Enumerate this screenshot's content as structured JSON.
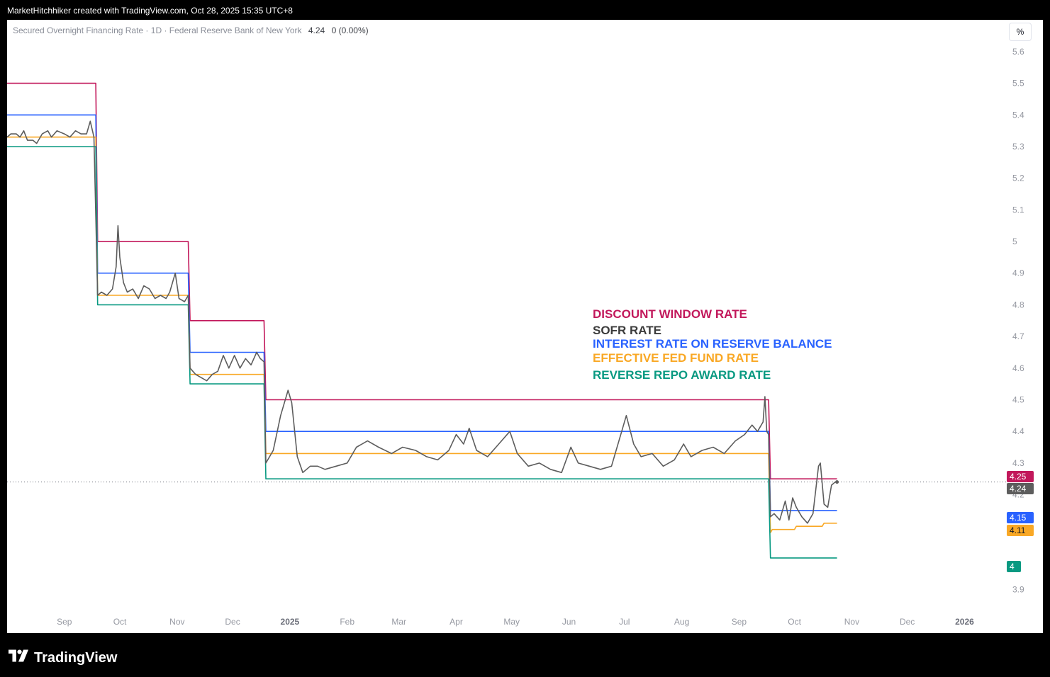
{
  "header": {
    "credit": "MarketHitchhiker created with TradingView.com, Oct 28, 2025 15:35 UTC+8"
  },
  "legend": {
    "title": "Secured Overnight Financing Rate · 1D · Federal Reserve Bank of New York",
    "last_value": "4.24",
    "change": "0 (0.00%)"
  },
  "unit_button": "%",
  "footer": {
    "brand": "TradingView"
  },
  "colors": {
    "discount": "#c2185b",
    "sofr": "#5d5d5d",
    "iorb": "#2962ff",
    "effr": "#f9a825",
    "rrp": "#089981"
  },
  "chart_data": {
    "type": "line",
    "title": "",
    "ylim": [
      3.87,
      5.62
    ],
    "y_ticks": [
      "5.6",
      "5.5",
      "5.4",
      "5.3",
      "5.2",
      "5.1",
      "5",
      "4.9",
      "4.8",
      "4.7",
      "4.6",
      "4.5",
      "4.4",
      "4.3",
      "4.2",
      "3.9"
    ],
    "x_ticks": [
      "Sep",
      "Oct",
      "Nov",
      "Dec",
      "2025",
      "Feb",
      "Mar",
      "Apr",
      "May",
      "Jun",
      "Jul",
      "Aug",
      "Sep",
      "Oct",
      "Nov",
      "Dec",
      "2026"
    ],
    "x_range": [
      "2024-08-01",
      "2026-01-20"
    ],
    "annotations": [
      "DISCOUNT WINDOW RATE",
      "SOFR RATE",
      "INTEREST RATE ON RESERVE BALANCE",
      "EFFECTIVE FED FUND RATE",
      " REVERSE REPO AWARD RATE"
    ],
    "series": [
      {
        "key": "discount",
        "color": "#c2185b",
        "points": [
          [
            "2024-08-01",
            5.5
          ],
          [
            "2024-09-18",
            5.5
          ],
          [
            "2024-09-19",
            5.0
          ],
          [
            "2024-11-07",
            5.0
          ],
          [
            "2024-11-08",
            4.75
          ],
          [
            "2024-12-18",
            4.75
          ],
          [
            "2024-12-19",
            4.5
          ],
          [
            "2025-09-17",
            4.5
          ],
          [
            "2025-09-18",
            4.25
          ],
          [
            "2025-10-24",
            4.25
          ]
        ],
        "last_label": "4.25"
      },
      {
        "key": "iorb",
        "color": "#2962ff",
        "points": [
          [
            "2024-08-01",
            5.4
          ],
          [
            "2024-09-18",
            5.4
          ],
          [
            "2024-09-19",
            4.9
          ],
          [
            "2024-11-07",
            4.9
          ],
          [
            "2024-11-08",
            4.65
          ],
          [
            "2024-12-18",
            4.65
          ],
          [
            "2024-12-19",
            4.4
          ],
          [
            "2025-09-17",
            4.4
          ],
          [
            "2025-09-18",
            4.15
          ],
          [
            "2025-10-24",
            4.15
          ]
        ],
        "last_label": "4.15"
      },
      {
        "key": "effr",
        "color": "#f9a825",
        "points": [
          [
            "2024-08-01",
            5.33
          ],
          [
            "2024-09-18",
            5.33
          ],
          [
            "2024-09-19",
            4.83
          ],
          [
            "2024-11-07",
            4.83
          ],
          [
            "2024-11-08",
            4.58
          ],
          [
            "2024-12-18",
            4.58
          ],
          [
            "2024-12-19",
            4.33
          ],
          [
            "2025-09-17",
            4.33
          ],
          [
            "2025-09-18",
            4.08
          ],
          [
            "2025-09-19",
            4.09
          ],
          [
            "2025-10-01",
            4.09
          ],
          [
            "2025-10-02",
            4.1
          ],
          [
            "2025-10-16",
            4.1
          ],
          [
            "2025-10-17",
            4.11
          ],
          [
            "2025-10-24",
            4.11
          ]
        ],
        "last_label": "4.11"
      },
      {
        "key": "rrp",
        "color": "#089981",
        "points": [
          [
            "2024-08-01",
            5.3
          ],
          [
            "2024-09-18",
            5.3
          ],
          [
            "2024-09-19",
            4.8
          ],
          [
            "2024-11-07",
            4.8
          ],
          [
            "2024-11-08",
            4.55
          ],
          [
            "2024-12-18",
            4.55
          ],
          [
            "2024-12-19",
            4.25
          ],
          [
            "2025-09-17",
            4.25
          ],
          [
            "2025-09-18",
            4.0
          ],
          [
            "2025-10-24",
            4.0
          ]
        ],
        "last_label": "4"
      },
      {
        "key": "sofr",
        "color": "#5d5d5d",
        "points": [
          [
            "2024-08-01",
            5.33
          ],
          [
            "2024-08-03",
            5.34
          ],
          [
            "2024-08-06",
            5.34
          ],
          [
            "2024-08-08",
            5.33
          ],
          [
            "2024-08-10",
            5.35
          ],
          [
            "2024-08-12",
            5.32
          ],
          [
            "2024-08-15",
            5.32
          ],
          [
            "2024-08-17",
            5.31
          ],
          [
            "2024-08-20",
            5.34
          ],
          [
            "2024-08-23",
            5.35
          ],
          [
            "2024-08-25",
            5.33
          ],
          [
            "2024-08-28",
            5.35
          ],
          [
            "2024-09-01",
            5.34
          ],
          [
            "2024-09-04",
            5.33
          ],
          [
            "2024-09-07",
            5.35
          ],
          [
            "2024-09-10",
            5.34
          ],
          [
            "2024-09-13",
            5.34
          ],
          [
            "2024-09-15",
            5.38
          ],
          [
            "2024-09-17",
            5.33
          ],
          [
            "2024-09-19",
            4.83
          ],
          [
            "2024-09-21",
            4.84
          ],
          [
            "2024-09-24",
            4.83
          ],
          [
            "2024-09-27",
            4.85
          ],
          [
            "2024-09-29",
            4.92
          ],
          [
            "2024-09-30",
            5.05
          ],
          [
            "2024-10-01",
            4.95
          ],
          [
            "2024-10-03",
            4.87
          ],
          [
            "2024-10-05",
            4.84
          ],
          [
            "2024-10-08",
            4.85
          ],
          [
            "2024-10-11",
            4.82
          ],
          [
            "2024-10-14",
            4.86
          ],
          [
            "2024-10-17",
            4.85
          ],
          [
            "2024-10-20",
            4.82
          ],
          [
            "2024-10-23",
            4.83
          ],
          [
            "2024-10-26",
            4.82
          ],
          [
            "2024-10-28",
            4.84
          ],
          [
            "2024-10-31",
            4.9
          ],
          [
            "2024-11-02",
            4.82
          ],
          [
            "2024-11-05",
            4.81
          ],
          [
            "2024-11-07",
            4.83
          ],
          [
            "2024-11-08",
            4.6
          ],
          [
            "2024-11-11",
            4.58
          ],
          [
            "2024-11-14",
            4.57
          ],
          [
            "2024-11-17",
            4.56
          ],
          [
            "2024-11-20",
            4.58
          ],
          [
            "2024-11-23",
            4.59
          ],
          [
            "2024-11-26",
            4.64
          ],
          [
            "2024-11-29",
            4.6
          ],
          [
            "2024-12-02",
            4.64
          ],
          [
            "2024-12-05",
            4.6
          ],
          [
            "2024-12-08",
            4.63
          ],
          [
            "2024-12-11",
            4.61
          ],
          [
            "2024-12-14",
            4.65
          ],
          [
            "2024-12-16",
            4.63
          ],
          [
            "2024-12-18",
            4.62
          ],
          [
            "2024-12-19",
            4.3
          ],
          [
            "2024-12-23",
            4.34
          ],
          [
            "2024-12-27",
            4.45
          ],
          [
            "2024-12-31",
            4.53
          ],
          [
            "2025-01-02",
            4.49
          ],
          [
            "2025-01-05",
            4.32
          ],
          [
            "2025-01-08",
            4.27
          ],
          [
            "2025-01-12",
            4.29
          ],
          [
            "2025-01-16",
            4.29
          ],
          [
            "2025-01-20",
            4.28
          ],
          [
            "2025-01-26",
            4.29
          ],
          [
            "2025-02-01",
            4.3
          ],
          [
            "2025-02-06",
            4.35
          ],
          [
            "2025-02-12",
            4.37
          ],
          [
            "2025-02-18",
            4.35
          ],
          [
            "2025-02-25",
            4.33
          ],
          [
            "2025-03-03",
            4.35
          ],
          [
            "2025-03-10",
            4.34
          ],
          [
            "2025-03-16",
            4.32
          ],
          [
            "2025-03-22",
            4.31
          ],
          [
            "2025-03-28",
            4.34
          ],
          [
            "2025-04-01",
            4.39
          ],
          [
            "2025-04-05",
            4.36
          ],
          [
            "2025-04-08",
            4.41
          ],
          [
            "2025-04-12",
            4.34
          ],
          [
            "2025-04-18",
            4.32
          ],
          [
            "2025-04-24",
            4.36
          ],
          [
            "2025-04-30",
            4.4
          ],
          [
            "2025-05-04",
            4.33
          ],
          [
            "2025-05-10",
            4.29
          ],
          [
            "2025-05-16",
            4.3
          ],
          [
            "2025-05-22",
            4.28
          ],
          [
            "2025-05-28",
            4.27
          ],
          [
            "2025-06-02",
            4.35
          ],
          [
            "2025-06-06",
            4.3
          ],
          [
            "2025-06-12",
            4.29
          ],
          [
            "2025-06-18",
            4.28
          ],
          [
            "2025-06-24",
            4.29
          ],
          [
            "2025-06-30",
            4.41
          ],
          [
            "2025-07-02",
            4.45
          ],
          [
            "2025-07-06",
            4.36
          ],
          [
            "2025-07-10",
            4.32
          ],
          [
            "2025-07-16",
            4.33
          ],
          [
            "2025-07-22",
            4.29
          ],
          [
            "2025-07-28",
            4.31
          ],
          [
            "2025-08-02",
            4.36
          ],
          [
            "2025-08-06",
            4.32
          ],
          [
            "2025-08-12",
            4.34
          ],
          [
            "2025-08-18",
            4.35
          ],
          [
            "2025-08-24",
            4.33
          ],
          [
            "2025-08-30",
            4.37
          ],
          [
            "2025-09-04",
            4.39
          ],
          [
            "2025-09-08",
            4.42
          ],
          [
            "2025-09-11",
            4.4
          ],
          [
            "2025-09-14",
            4.43
          ],
          [
            "2025-09-15",
            4.51
          ],
          [
            "2025-09-16",
            4.4
          ],
          [
            "2025-09-17",
            4.39
          ],
          [
            "2025-09-18",
            4.13
          ],
          [
            "2025-09-20",
            4.14
          ],
          [
            "2025-09-23",
            4.12
          ],
          [
            "2025-09-26",
            4.18
          ],
          [
            "2025-09-28",
            4.12
          ],
          [
            "2025-09-30",
            4.19
          ],
          [
            "2025-10-02",
            4.16
          ],
          [
            "2025-10-05",
            4.13
          ],
          [
            "2025-10-08",
            4.11
          ],
          [
            "2025-10-11",
            4.14
          ],
          [
            "2025-10-14",
            4.29
          ],
          [
            "2025-10-15",
            4.3
          ],
          [
            "2025-10-17",
            4.17
          ],
          [
            "2025-10-19",
            4.16
          ],
          [
            "2025-10-21",
            4.23
          ],
          [
            "2025-10-23",
            4.24
          ],
          [
            "2025-10-24",
            4.24
          ]
        ],
        "last_label": "4.24"
      }
    ]
  }
}
